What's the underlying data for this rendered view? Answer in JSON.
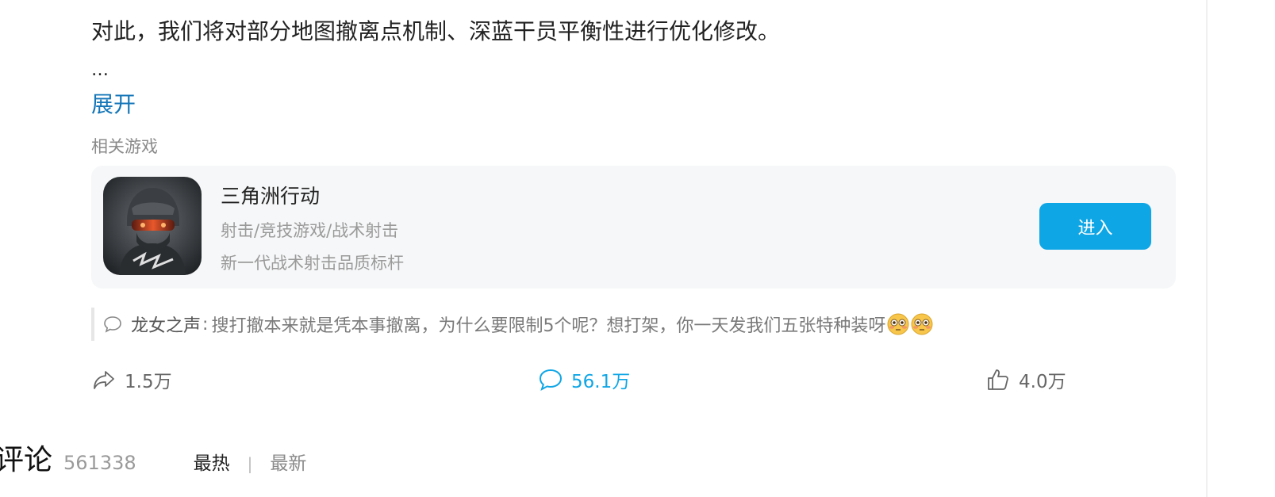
{
  "post": {
    "text": "对此，我们将对部分地图撤离点机制、深蓝干员平衡性进行优化修改。",
    "ellipsis": "…",
    "expand_label": "展开"
  },
  "related": {
    "label": "相关游戏",
    "game": {
      "name": "三角洲行动",
      "tags": "射击/竞技游戏/战术射击",
      "slogan": "新一代战术射击品质标杆",
      "enter_label": "进入",
      "icon": "game-cover-soldier"
    }
  },
  "hot_comment": {
    "icon": "comment-bubble-icon",
    "author": "龙女之声",
    "separator": ":",
    "text": "搜打撤本来就是凭本事撤离，为什么要限制5个呢？想打架，你一天发我们五张特种装呀",
    "emoji": "flushed-face"
  },
  "actions": {
    "share_count": "1.5万",
    "comment_count": "56.1万",
    "like_count": "4.0万"
  },
  "comments": {
    "title": "评论",
    "count": "561338",
    "sort_hot": "最热",
    "sort_divider": "|",
    "sort_new": "最新"
  },
  "colors": {
    "accent": "#0fa6e6",
    "link": "#1476b8",
    "muted": "#9a9a9a"
  }
}
